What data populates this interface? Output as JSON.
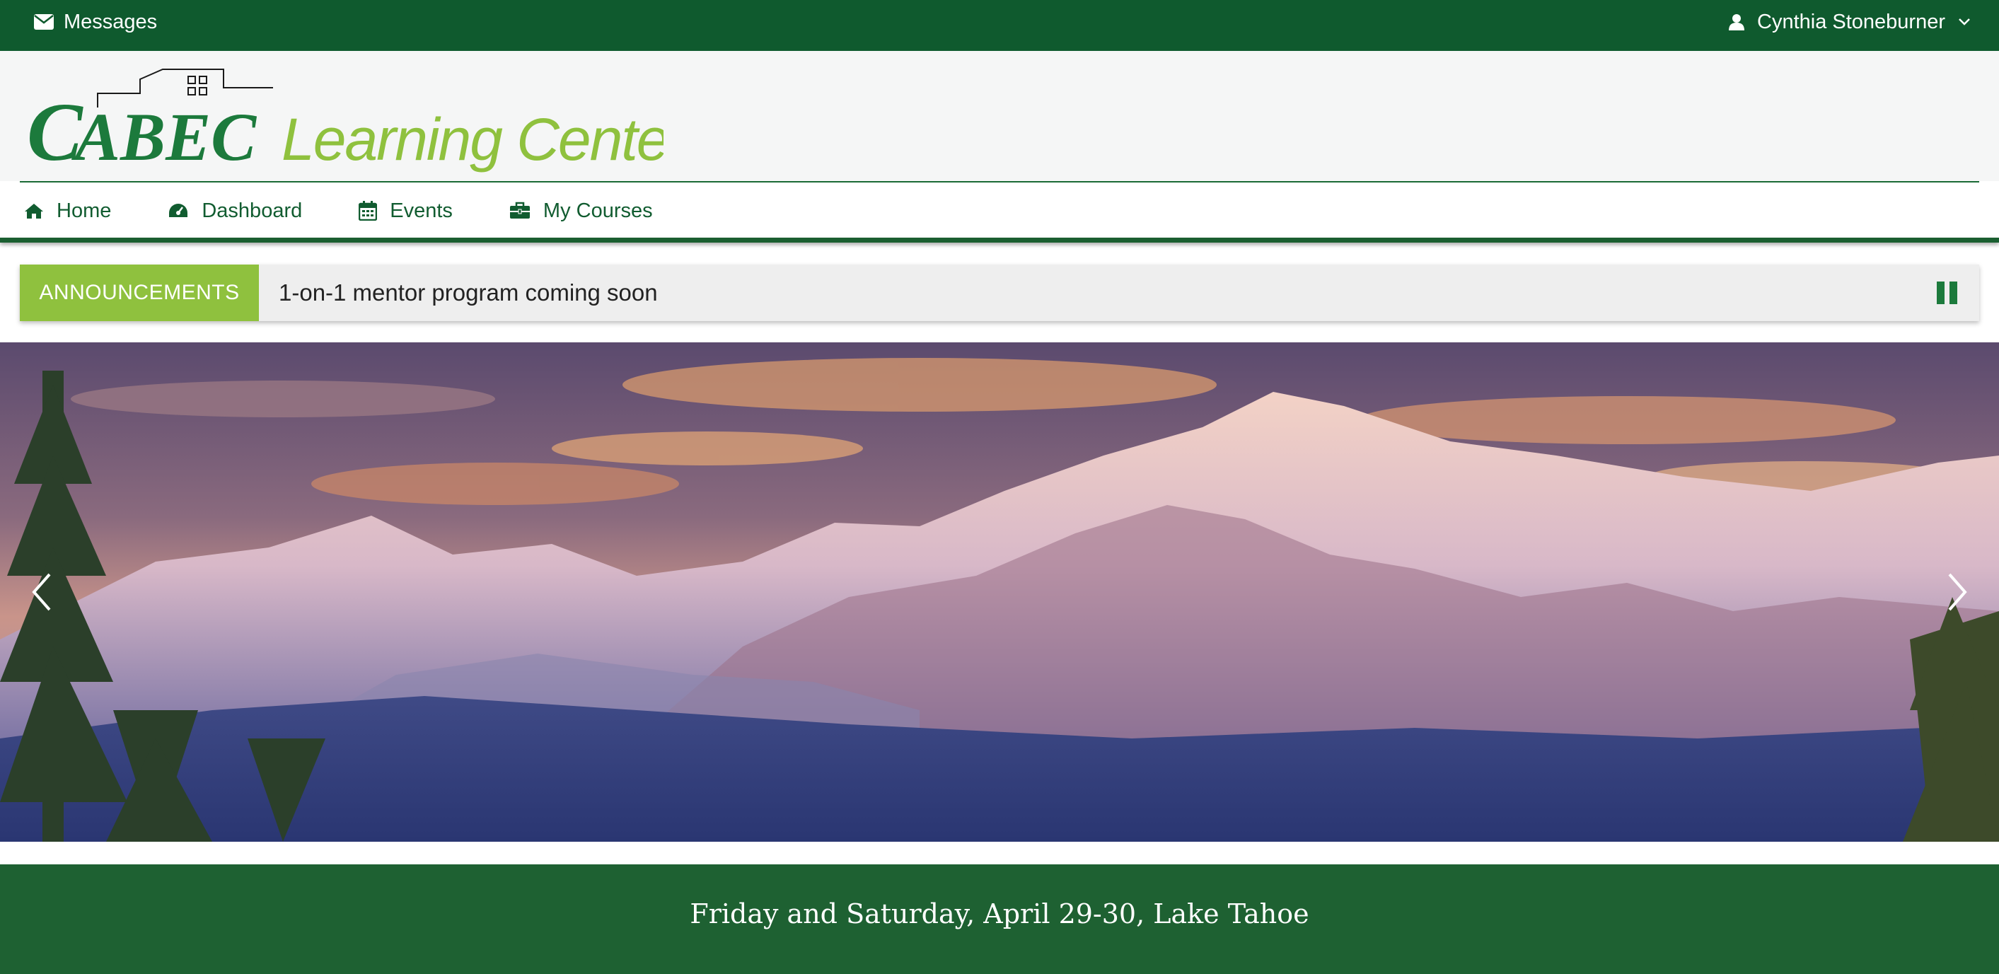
{
  "topbar": {
    "messages_label": "Messages",
    "user_name": "Cynthia Stoneburner"
  },
  "logo": {
    "brand": "CABEC",
    "tagline": "Learning Center"
  },
  "nav": {
    "items": [
      {
        "label": "Home",
        "icon": "home-icon"
      },
      {
        "label": "Dashboard",
        "icon": "dashboard-icon"
      },
      {
        "label": "Events",
        "icon": "calendar-icon"
      },
      {
        "label": "My Courses",
        "icon": "briefcase-icon"
      }
    ]
  },
  "announcements": {
    "label": "ANNOUNCEMENTS",
    "text": "1-on-1 mentor program coming soon"
  },
  "slider": {
    "caption": "Friday and Saturday, April 29-30, Lake Tahoe"
  },
  "colors": {
    "dark_green": "#0f5a2e",
    "lime_green": "#8fc13e",
    "band_green": "#1e6132"
  }
}
